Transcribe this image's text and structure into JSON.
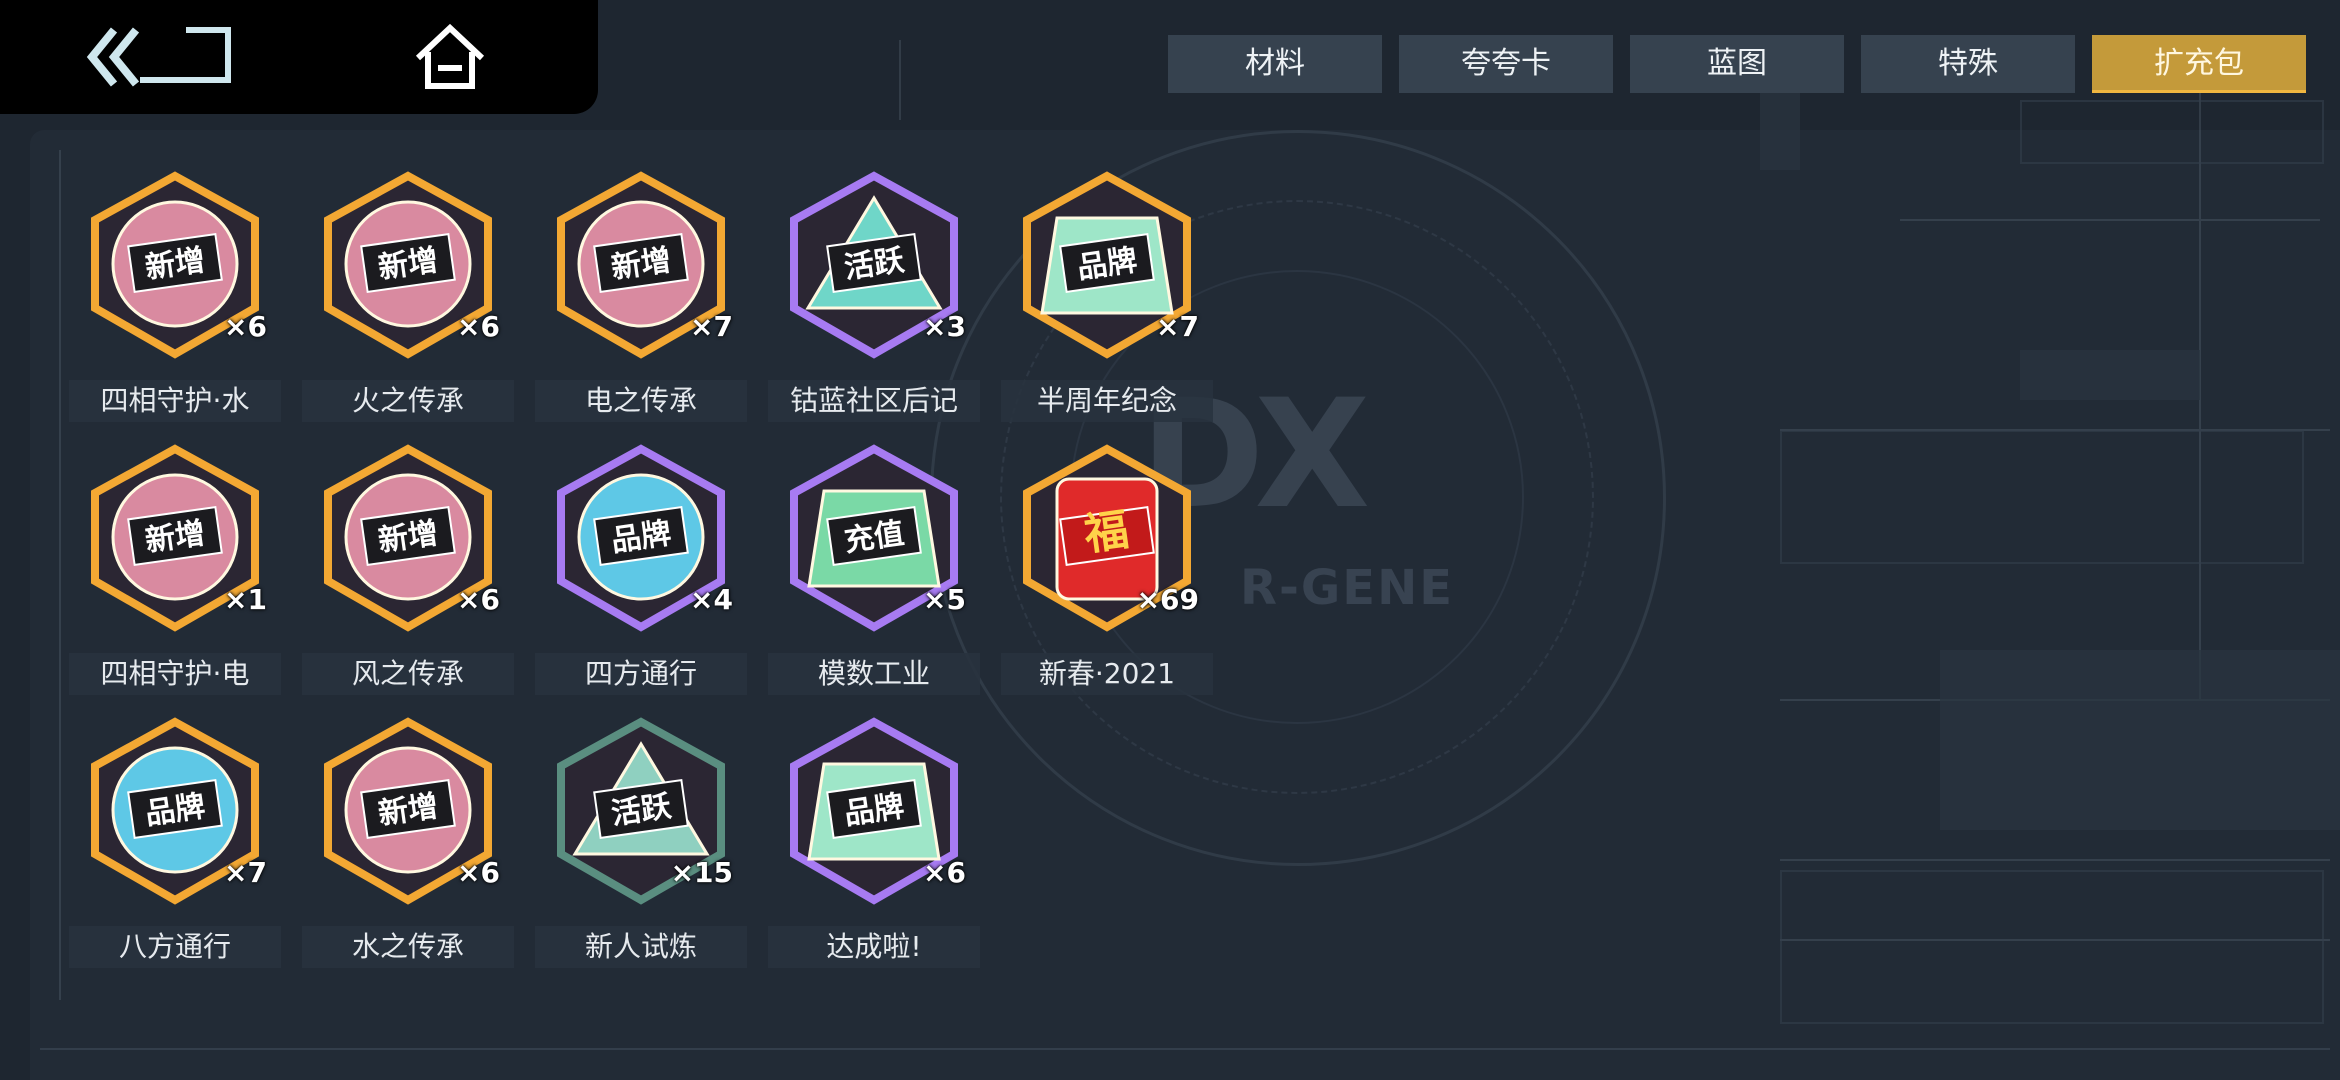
{
  "nav": {
    "back_icon": "double-chevron-left-icon",
    "home_icon": "home-icon"
  },
  "tabs": [
    {
      "label": "材料"
    },
    {
      "label": "夸夸卡"
    },
    {
      "label": "蓝图"
    },
    {
      "label": "特殊"
    },
    {
      "label": "扩充包",
      "active": true
    }
  ],
  "background": {
    "logo_sub": "R-GENE"
  },
  "colors": {
    "accent": "#c49a3a",
    "tab_bg": "#36424f",
    "panel_bg": "#222b36"
  },
  "items": [
    {
      "name": "四相守护·水",
      "count": "×6",
      "badge": "新增",
      "frame": "gold-round"
    },
    {
      "name": "火之传承",
      "count": "×6",
      "badge": "新增",
      "frame": "gold-round"
    },
    {
      "name": "电之传承",
      "count": "×7",
      "badge": "新增",
      "frame": "gold-round"
    },
    {
      "name": "钴蓝社区后记",
      "count": "×3",
      "badge": "活跃",
      "frame": "purple-triangle"
    },
    {
      "name": "半周年纪念",
      "count": "×7",
      "badge": "品牌",
      "frame": "gold-box"
    },
    {
      "name": "四相守护·电",
      "count": "×1",
      "badge": "新增",
      "frame": "gold-round"
    },
    {
      "name": "风之传承",
      "count": "×6",
      "badge": "新增",
      "frame": "gold-round"
    },
    {
      "name": "四方通行",
      "count": "×4",
      "badge": "品牌",
      "frame": "purple-blue-round"
    },
    {
      "name": "模数工业",
      "count": "×5",
      "badge": "充值",
      "frame": "purple-cube"
    },
    {
      "name": "新春·2021",
      "count": "×69",
      "badge": "福",
      "frame": "gold-lantern"
    },
    {
      "name": "八方通行",
      "count": "×7",
      "badge": "品牌",
      "frame": "gold-blue-round"
    },
    {
      "name": "水之传承",
      "count": "×6",
      "badge": "新增",
      "frame": "gold-round"
    },
    {
      "name": "新人试炼",
      "count": "×15",
      "badge": "活跃",
      "frame": "green-triangle"
    },
    {
      "name": "达成啦!",
      "count": "×6",
      "badge": "品牌",
      "frame": "purple-box"
    }
  ]
}
